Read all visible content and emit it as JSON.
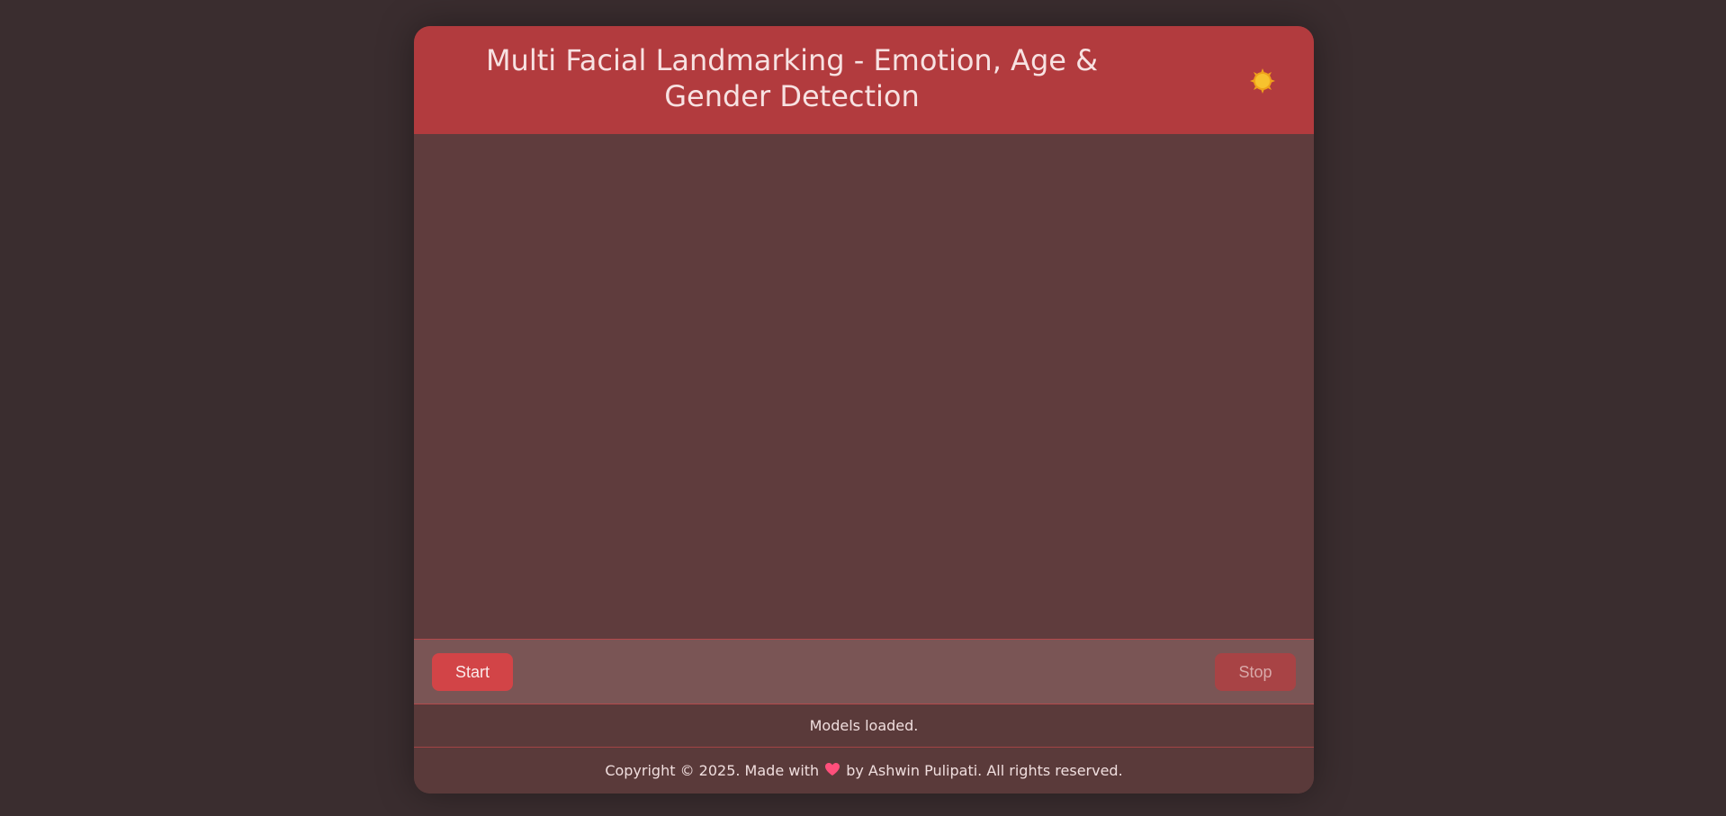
{
  "header": {
    "title": "Multi Facial Landmarking - Emotion, Age & Gender Detection",
    "theme_icon": "sun-icon"
  },
  "controls": {
    "start_label": "Start",
    "stop_label": "Stop"
  },
  "status": {
    "text": "Models loaded."
  },
  "footer": {
    "prefix": "Copyright © 2025. Made with",
    "heart_icon": "heart-icon",
    "suffix": "by Ashwin Pulipati. All rights reserved."
  },
  "colors": {
    "background": "#3a2d2f",
    "header": "#b23b3e",
    "start_button": "#d24447",
    "stop_button": "#a84345"
  }
}
